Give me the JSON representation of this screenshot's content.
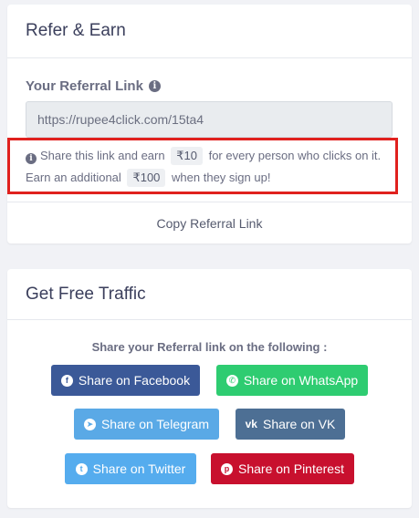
{
  "refer": {
    "title": "Refer & Earn",
    "label": "Your Referral Link",
    "link": "https://rupee4click.com/15ta4",
    "hint_part1": "Share this link and earn",
    "hint_amount1": "₹10",
    "hint_part2": "for every person who clicks on it. Earn an additional",
    "hint_amount2": "₹100",
    "hint_part3": "when they sign up!",
    "copy_label": "Copy Referral Link"
  },
  "traffic": {
    "title": "Get Free Traffic",
    "caption": "Share your Referral link on the following :",
    "buttons": {
      "facebook": {
        "label": "Share on Facebook",
        "icon": "facebook-icon",
        "color": "#3b5998"
      },
      "whatsapp": {
        "label": "Share on WhatsApp",
        "icon": "whatsapp-icon",
        "color": "#2ecc71"
      },
      "telegram": {
        "label": "Share on Telegram",
        "icon": "telegram-icon",
        "color": "#5aa9e6"
      },
      "vk": {
        "label": "Share on VK",
        "icon": "vk-icon",
        "color": "#4d6f94"
      },
      "twitter": {
        "label": "Share on Twitter",
        "icon": "twitter-icon",
        "color": "#55acee"
      },
      "pinterest": {
        "label": "Share on Pinterest",
        "icon": "pinterest-icon",
        "color": "#c8102e"
      }
    }
  },
  "highlight_color": "#e0211e"
}
